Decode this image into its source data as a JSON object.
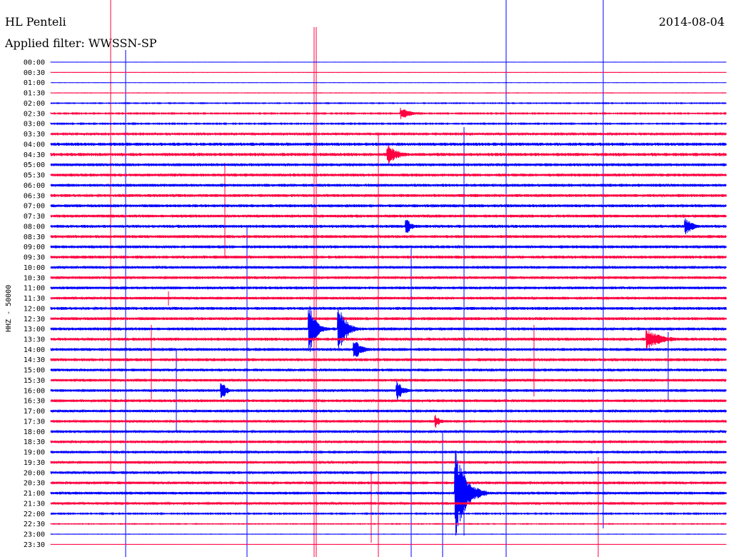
{
  "header": {
    "station": "HL Penteli",
    "filter_text": "Applied filter: WWSSN-SP",
    "date": "2014-08-04"
  },
  "chart_data": {
    "type": "line",
    "title": "HL Penteli",
    "subtitle": "Applied filter: WWSSN-SP",
    "date": "2014-08-04",
    "ylabel": "HHZ - 50000",
    "xlabel": "",
    "trace_colors": [
      "#0000ff",
      "#ff0040"
    ],
    "row_labels": [
      "00:00",
      "00:30",
      "01:00",
      "01:30",
      "02:00",
      "02:30",
      "03:00",
      "03:30",
      "04:00",
      "04:30",
      "05:00",
      "05:30",
      "06:00",
      "06:30",
      "07:00",
      "07:30",
      "08:00",
      "08:30",
      "09:00",
      "09:30",
      "10:00",
      "10:30",
      "11:00",
      "11:30",
      "12:00",
      "12:30",
      "13:00",
      "13:30",
      "14:00",
      "14:30",
      "15:00",
      "15:30",
      "16:00",
      "16:30",
      "17:00",
      "17:30",
      "18:00",
      "18:30",
      "19:00",
      "19:30",
      "20:00",
      "20:30",
      "21:00",
      "21:30",
      "22:00",
      "22:30",
      "23:00",
      "23:30"
    ],
    "noise_level": [
      0.02,
      0.05,
      0.03,
      0.06,
      0.15,
      0.2,
      0.2,
      0.32,
      0.55,
      0.55,
      0.5,
      0.5,
      0.5,
      0.5,
      0.5,
      0.5,
      0.5,
      0.5,
      0.5,
      0.5,
      0.45,
      0.45,
      0.45,
      0.45,
      0.5,
      0.5,
      0.5,
      0.5,
      0.5,
      0.5,
      0.45,
      0.45,
      0.45,
      0.45,
      0.42,
      0.42,
      0.42,
      0.42,
      0.4,
      0.4,
      0.45,
      0.45,
      0.45,
      0.42,
      0.2,
      0.12,
      0.06,
      0.03
    ],
    "events": [
      {
        "row": "02:30",
        "minute": 15.6,
        "amplitude": 0.8,
        "duration_min": 1.2
      },
      {
        "row": "04:30",
        "minute": 15.0,
        "amplitude": 1.3,
        "duration_min": 1.4
      },
      {
        "row": "08:00",
        "minute": 15.8,
        "amplitude": 1.4,
        "duration_min": 0.6
      },
      {
        "row": "08:00",
        "minute": 28.2,
        "amplitude": 1.2,
        "duration_min": 1.0
      },
      {
        "row": "13:00",
        "minute": 11.5,
        "amplitude": 4.2,
        "duration_min": 0.8
      },
      {
        "row": "13:00",
        "minute": 12.8,
        "amplitude": 3.8,
        "duration_min": 0.9
      },
      {
        "row": "13:30",
        "minute": 26.5,
        "amplitude": 1.3,
        "duration_min": 2.2
      },
      {
        "row": "14:00",
        "minute": 13.5,
        "amplitude": 1.5,
        "duration_min": 1.0
      },
      {
        "row": "16:00",
        "minute": 7.6,
        "amplitude": 1.4,
        "duration_min": 0.6
      },
      {
        "row": "16:00",
        "minute": 15.4,
        "amplitude": 1.4,
        "duration_min": 0.8
      },
      {
        "row": "17:30",
        "minute": 17.1,
        "amplitude": 1.0,
        "duration_min": 0.6
      },
      {
        "row": "21:00",
        "minute": 18.0,
        "amplitude": 6.0,
        "duration_min": 1.4
      }
    ],
    "x_range_minutes": [
      0,
      30
    ],
    "grid": false,
    "legend": "none"
  }
}
